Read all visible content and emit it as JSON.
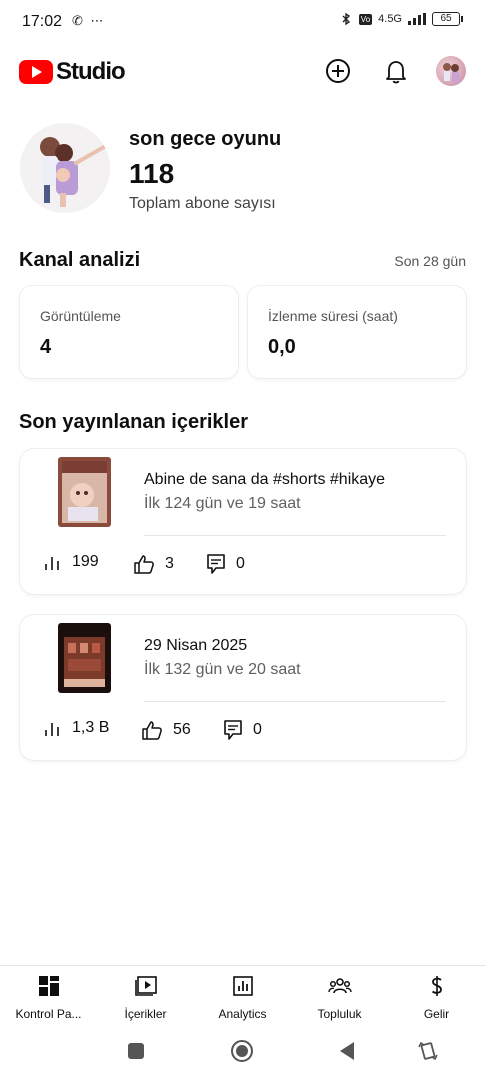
{
  "status_bar": {
    "time": "17:02",
    "left_icons": "✆ ⋯",
    "network": "4.5G",
    "battery": "65"
  },
  "app_bar": {
    "logo_text": "Studio",
    "icons": [
      "add-circle-icon",
      "bell-icon",
      "account-avatar"
    ]
  },
  "channel": {
    "name": "son gece oyunu",
    "subscriber_count": "118",
    "subscriber_label": "Toplam abone sayısı"
  },
  "analytics": {
    "title": "Kanal analizi",
    "range": "Son 28 gün",
    "views_label": "Görüntüleme",
    "views_value": "4",
    "watch_time_label": "İzlenme süresi (saat)",
    "watch_time_value": "0,0"
  },
  "recent": {
    "title": "Son yayınlanan içerikler",
    "items": [
      {
        "title": "Abine de sana da #shorts #hikaye",
        "period": "İlk 124 gün ve 19 saat",
        "views": "199",
        "likes": "3",
        "comments": "0"
      },
      {
        "title": "29 Nisan 2025",
        "period": "İlk 132 gün ve 20 saat",
        "views": "1,3 B",
        "likes": "56",
        "comments": "0"
      }
    ]
  },
  "bottom_nav": {
    "dashboard": "Kontrol Pa...",
    "content": "İçerikler",
    "analytics": "Analytics",
    "community": "Topluluk",
    "earn": "Gelir"
  },
  "colors": {
    "brand_red": "#ff0000",
    "text": "#0f0f0f",
    "secondary": "#606060"
  }
}
